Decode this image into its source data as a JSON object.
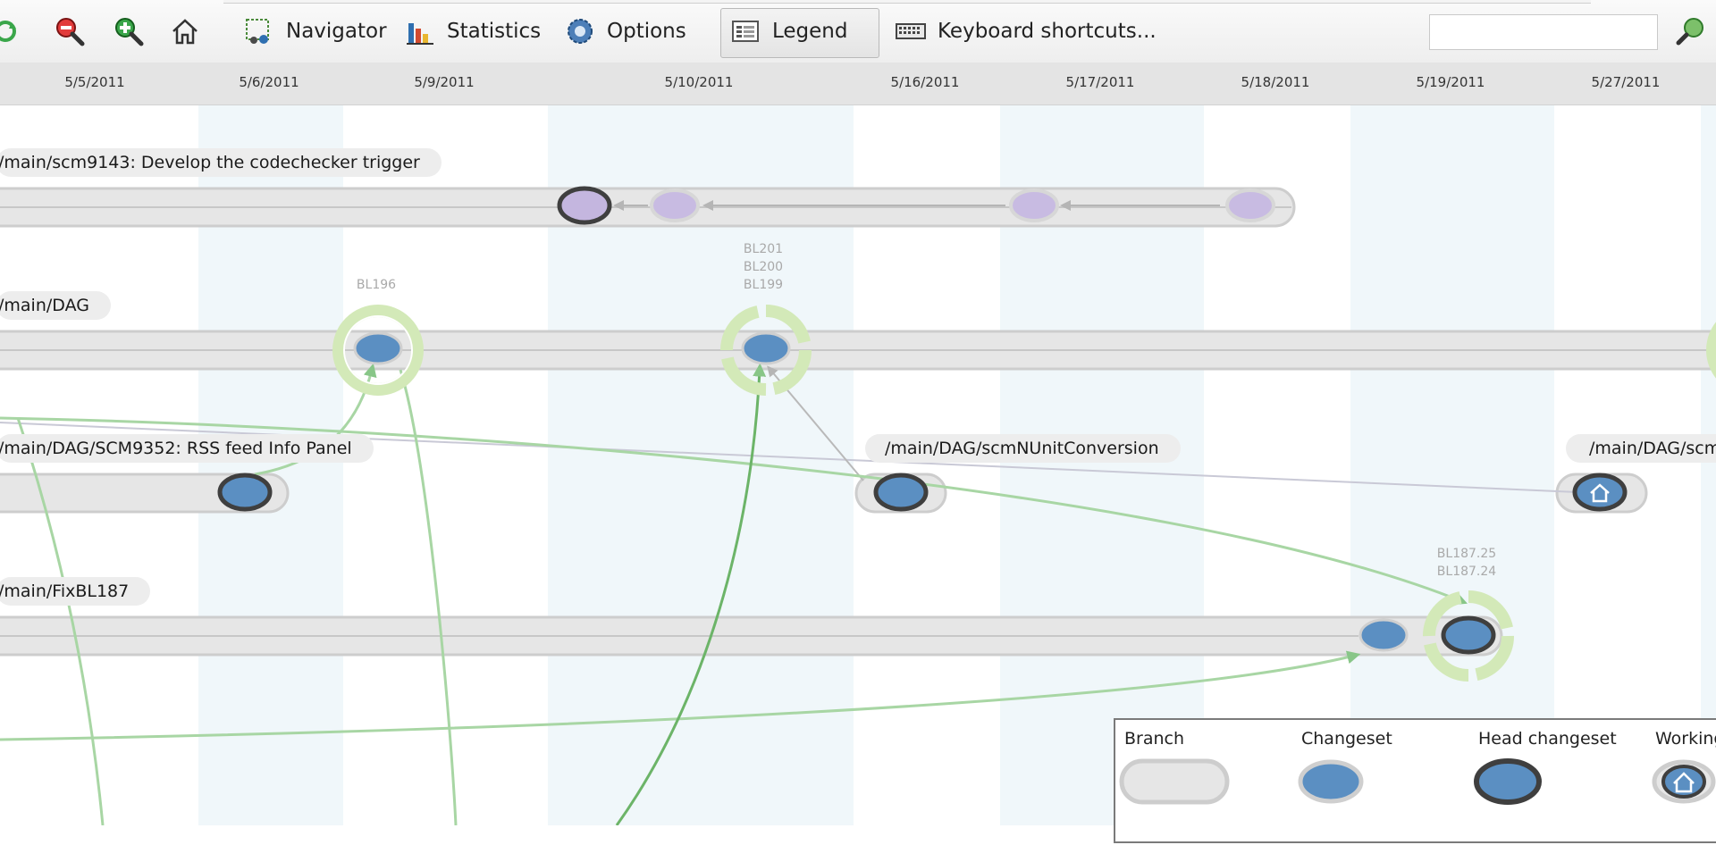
{
  "toolbar": {
    "navigator_label": "Navigator",
    "statistics_label": "Statistics",
    "options_label": "Options",
    "legend_label": "Legend",
    "shortcuts_label": "Keyboard shortcuts...",
    "search_value": "",
    "icons": [
      "refresh-icon",
      "zoom-out-icon",
      "zoom-in-icon",
      "home-icon",
      "navigator-icon",
      "statistics-icon",
      "options-gear-icon",
      "legend-icon",
      "keyboard-icon",
      "search-icon"
    ]
  },
  "dates": [
    "5/5/2011",
    "5/6/2011",
    "5/9/2011",
    "5/10/2011",
    "5/16/2011",
    "5/17/2011",
    "5/18/2011",
    "5/19/2011",
    "5/27/2011"
  ],
  "branches": {
    "scm9143": "/main/scm9143: Develop the codechecker trigger",
    "dag": "/main/DAG",
    "scm9352": "/main/DAG/SCM9352: RSS feed Info Panel",
    "nunit": "/main/DAG/scmNUnitConversion",
    "dag_scm_partial": "/main/DAG/scm",
    "fixbl187": "/main/FixBL187"
  },
  "baselines": {
    "bl196": "BL196",
    "bl201": "BL201",
    "bl200": "BL200",
    "bl199": "BL199",
    "bl187_25": "BL187.25",
    "bl187_24": "BL187.24"
  },
  "legend": {
    "branch": "Branch",
    "changeset": "Changeset",
    "head_changeset": "Head changeset",
    "working": "Working"
  },
  "colors": {
    "changeset_blue": "#5b8fc2",
    "purple_changeset": "#c3b4dc",
    "branch_gray": "#d9d9d9",
    "head_border": "#3a3a3a",
    "merge_green": "#7cc07a",
    "label_ring": "#cfe8b0",
    "band_tint": "#f0f7fa"
  }
}
